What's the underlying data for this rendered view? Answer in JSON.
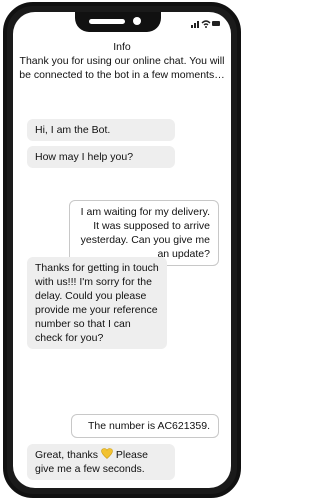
{
  "info": {
    "title": "Info",
    "text": "Thank you for using our online chat. You will be connected to the bot in a few moments…"
  },
  "messages": [
    {
      "sender": "bot",
      "text": "Hi, I am the Bot."
    },
    {
      "sender": "bot",
      "text": "How may I help you?"
    },
    {
      "sender": "user",
      "text": "I am waiting for my delivery. It was supposed to arrive yesterday. Can you give me an update?"
    },
    {
      "sender": "bot",
      "text": "Thanks for getting in touch with us!!! I'm sorry for the delay. Could you please provide me your reference number so that I can check for you?"
    },
    {
      "sender": "user",
      "text": "The number is AC621359."
    },
    {
      "sender": "bot",
      "text_before": "Great, thanks",
      "text_after": "Please give me a few seconds."
    }
  ],
  "icons": {
    "heart": "heart-icon",
    "signal": "signal-icon",
    "wifi": "wifi-icon",
    "battery": "battery-icon"
  },
  "colors": {
    "bot_bubble": "#eeeeee",
    "user_bubble_border": "#c8c8c8",
    "heart": "#f2c230",
    "frame": "#111111"
  }
}
